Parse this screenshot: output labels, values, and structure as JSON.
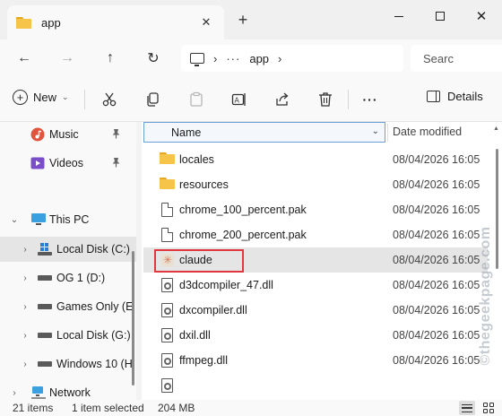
{
  "window": {
    "tab_title": "app",
    "new_tab_glyph": "+",
    "close_tab_glyph": "✕",
    "close_window_glyph": "✕"
  },
  "nav": {
    "back_glyph": "←",
    "forward_glyph": "→",
    "up_glyph": "↑",
    "refresh_glyph": "↻",
    "address_overflow": "···",
    "address_separator": "›",
    "current_folder": "app",
    "search_placeholder": "Searc"
  },
  "toolbar": {
    "new_label": "New",
    "details_label": "Details",
    "more_glyph": "···"
  },
  "sidebar": {
    "items": [
      {
        "label": "Music",
        "icon": "music-icon",
        "pinned": true
      },
      {
        "label": "Videos",
        "icon": "videos-icon",
        "pinned": true
      },
      {
        "label": "This PC",
        "icon": "this-pc-icon",
        "expanded": true
      },
      {
        "label": "Local Disk (C:)",
        "icon": "windows-drive-icon",
        "selected": true
      },
      {
        "label": "OG 1 (D:)",
        "icon": "drive-icon"
      },
      {
        "label": "Games Only (E",
        "icon": "drive-icon"
      },
      {
        "label": "Local Disk (G:)",
        "icon": "drive-icon"
      },
      {
        "label": "Windows 10 (H",
        "icon": "drive-icon"
      },
      {
        "label": "Network",
        "icon": "network-icon"
      }
    ],
    "expand_glyph": "›",
    "collapse_glyph": "⌄",
    "pin_glyph": "📌"
  },
  "columns": {
    "name": "Name",
    "date_modified": "Date modified",
    "sort_caret": "^",
    "dropdown_glyph": "⌄"
  },
  "files": [
    {
      "name": "locales",
      "type": "folder",
      "date": "08/04/2026 16:05"
    },
    {
      "name": "resources",
      "type": "folder",
      "date": "08/04/2026 16:05"
    },
    {
      "name": "chrome_100_percent.pak",
      "type": "file",
      "date": "08/04/2026 16:05"
    },
    {
      "name": "chrome_200_percent.pak",
      "type": "file",
      "date": "08/04/2026 16:05"
    },
    {
      "name": "claude",
      "type": "app",
      "date": "08/04/2026 16:05",
      "selected": true
    },
    {
      "name": "d3dcompiler_47.dll",
      "type": "dll",
      "date": "08/04/2026 16:05"
    },
    {
      "name": "dxcompiler.dll",
      "type": "dll",
      "date": "08/04/2026 16:05"
    },
    {
      "name": "dxil.dll",
      "type": "dll",
      "date": "08/04/2026 16:05"
    },
    {
      "name": "ffmpeg.dll",
      "type": "dll",
      "date": "08/04/2026 16:05"
    }
  ],
  "claude_icon_glyph": "✳",
  "status": {
    "item_count": "21 items",
    "selection": "1 item selected",
    "size": "204 MB"
  },
  "watermark": "©thegeekpage.com",
  "colors": {
    "accent": "#0067c0",
    "selection_bg": "#e5e5e5",
    "highlight_box": "#e0383e",
    "folder": "#f7c44a"
  }
}
